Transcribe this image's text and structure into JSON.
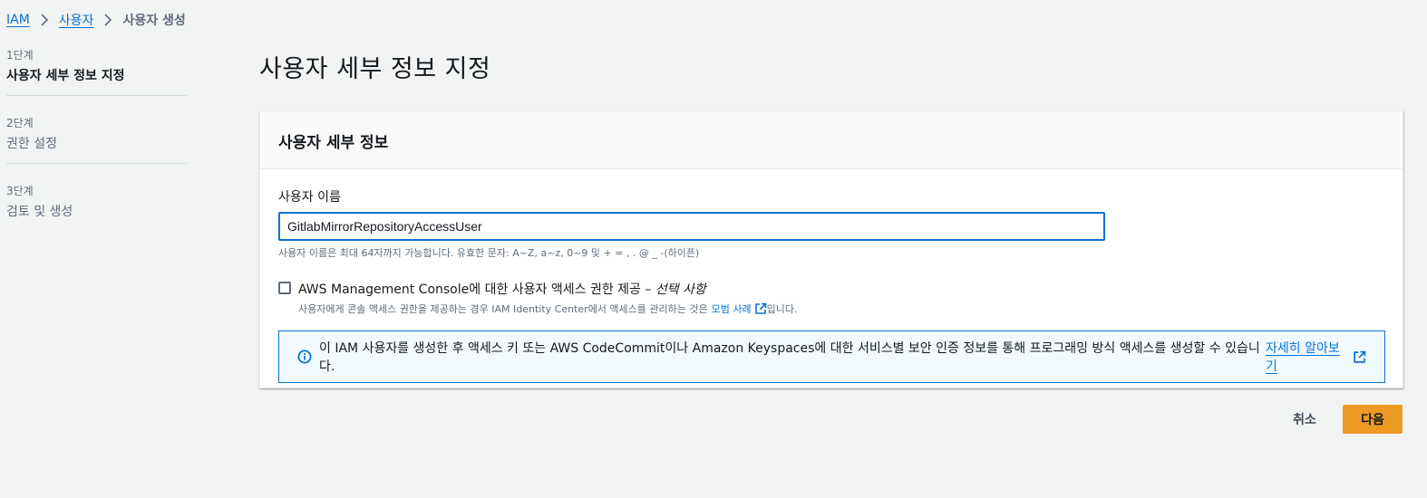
{
  "breadcrumb": {
    "items": [
      "IAM",
      "사용자"
    ],
    "current": "사용자 생성"
  },
  "steps": [
    {
      "number": "1단계",
      "label": "사용자 세부 정보 지정"
    },
    {
      "number": "2단계",
      "label": "권한 설정"
    },
    {
      "number": "3단계",
      "label": "검토 및 생성"
    }
  ],
  "page_title": "사용자 세부 정보 지정",
  "details": {
    "header": "사용자 세부 정보",
    "username_label": "사용자 이름",
    "username_value": "GitlabMirrorRepositoryAccessUser",
    "username_hint": "사용자 이름은 최대 64자까지 가능합니다. 유효한 문자: A~Z, a~z, 0~9 및 + = , . @ _ -(하이픈)",
    "console_access": {
      "title": "AWS Management Console에 대한 사용자 액세스 권한 제공 – ",
      "optional": "선택 사항",
      "desc_before": "사용자에게 콘솔 액세스 권한을 제공하는 경우 IAM Identity Center에서 액세스를 관리하는 것은",
      "desc_link": "모범 사례",
      "desc_after": "입니다."
    },
    "info": {
      "text": "이 IAM 사용자를 생성한 후 액세스 키 또는 AWS CodeCommit이나 Amazon Keyspaces에 대한 서비스별 보안 인증 정보를 통해 프로그래밍 방식 액세스를 생성할 수 있습니다.",
      "link": "자세히 알아보기"
    }
  },
  "footer": {
    "cancel_label": "취소",
    "next_label": "다음"
  },
  "colors": {
    "link": "#0972d3",
    "primary_button": "#ec9a23",
    "info_bg": "#f1faff"
  }
}
